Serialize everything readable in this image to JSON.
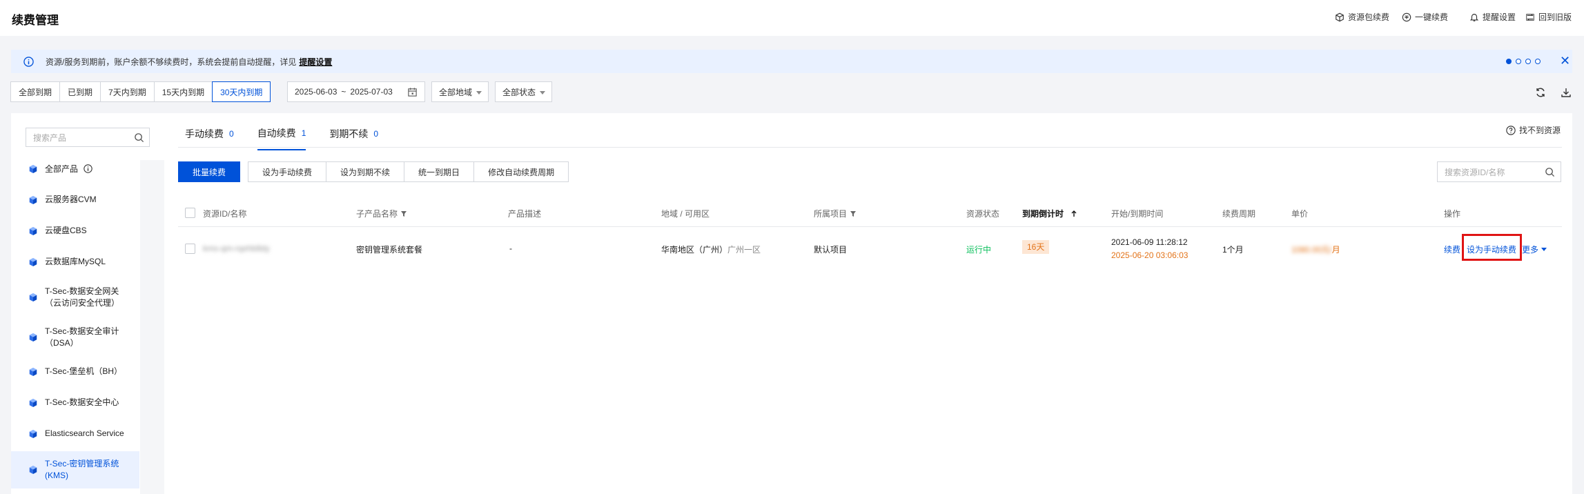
{
  "header": {
    "title": "续费管理",
    "links": [
      {
        "label": "资源包续费",
        "icon": "package-icon"
      },
      {
        "label": "一键续费",
        "icon": "renew-icon"
      },
      {
        "label": "提醒设置",
        "icon": "bell-icon"
      },
      {
        "label": "回到旧版",
        "icon": "switch-icon"
      }
    ]
  },
  "notice": {
    "text": "资源/服务到期前，账户余额不够续费时，系统会提前自动提醒，详见",
    "link": "提醒设置",
    "close": "✕"
  },
  "filters": {
    "buttons": [
      "全部到期",
      "已到期",
      "7天内到期",
      "15天内到期",
      "30天内到期"
    ],
    "active": "30天内到期",
    "date_start": "2025-06-03",
    "date_sep": "~",
    "date_end": "2025-07-03",
    "region": "全部地域",
    "status": "全部状态"
  },
  "sidebar": {
    "search_placeholder": "搜索产品",
    "items": [
      {
        "label": "全部产品"
      },
      {
        "label": "云服务器CVM"
      },
      {
        "label": "云硬盘CBS"
      },
      {
        "label": "云数据库MySQL"
      },
      {
        "label": "T-Sec-数据安全网关",
        "label2": "（云访问安全代理）"
      },
      {
        "label": "T-Sec-数据安全审计",
        "label2": "（DSA）"
      },
      {
        "label": "T-Sec-堡垒机（BH）"
      },
      {
        "label": "T-Sec-数据安全中心"
      },
      {
        "label": "Elasticsearch Service"
      },
      {
        "label": "T-Sec-密钥管理系统",
        "label2": "(KMS)"
      }
    ],
    "active_index": 9
  },
  "tabs": [
    {
      "label": "手动续费",
      "count": "0"
    },
    {
      "label": "自动续费",
      "count": "1"
    },
    {
      "label": "到期不续",
      "count": "0"
    }
  ],
  "not_found": "找不到资源",
  "actions": {
    "batch_renew": "批量续费",
    "buttons": [
      "设为手动续费",
      "设为到期不续",
      "统一到期日",
      "修改自动续费周期"
    ],
    "search_placeholder": "搜索资源ID/名称"
  },
  "table": {
    "headers": {
      "id": "资源ID/名称",
      "sub_product": "子产品名称",
      "desc": "产品描述",
      "region": "地域 / 可用区",
      "project": "所属项目",
      "status": "资源状态",
      "countdown": "到期倒计时",
      "time": "开始/到期时间",
      "period": "续费周期",
      "price": "单价",
      "ops": "操作"
    },
    "rows": [
      {
        "id": "kms-qm-rqehb8dy",
        "sub_product": "密钥管理系统套餐",
        "desc": "-",
        "region": "华南地区（广州）",
        "zone": "广州一区",
        "project": "默认项目",
        "status": "运行中",
        "countdown": "16天",
        "start": "2021-06-09 11:28:12",
        "end": "2025-06-20 03:06:03",
        "period": "1个月",
        "price_blur": "1080.00元/",
        "price_unit": "月",
        "op_renew": "续费",
        "op_manual": "设为手动续费",
        "op_more": "更多"
      }
    ]
  }
}
